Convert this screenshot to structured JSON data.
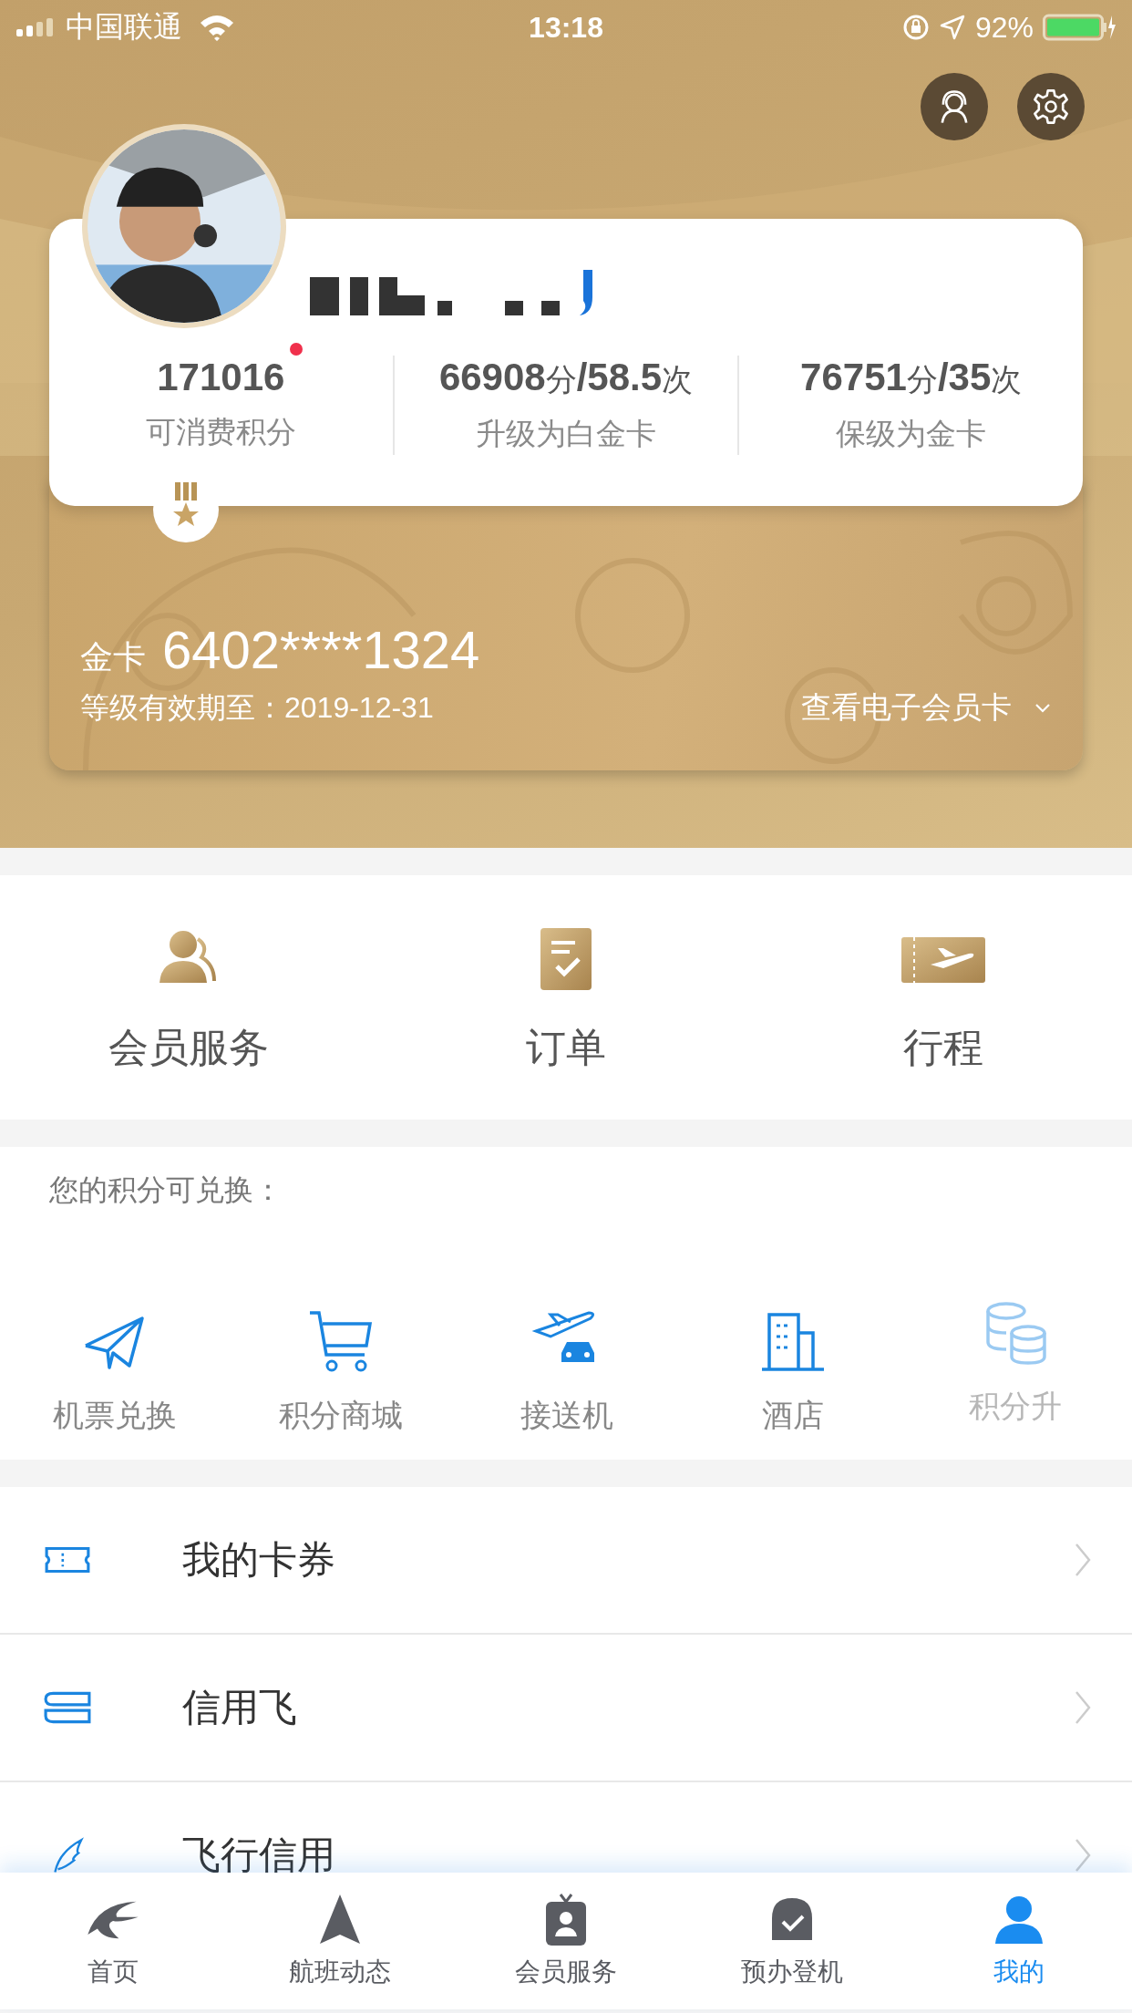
{
  "status_bar": {
    "carrier": "中国联通",
    "time": "13:18",
    "battery": "92%"
  },
  "profile": {
    "stats": [
      {
        "parts": [
          {
            "text": "171016",
            "kind": "num"
          }
        ],
        "label": "可消费积分"
      },
      {
        "parts": [
          {
            "text": "66908",
            "kind": "num"
          },
          {
            "text": "分",
            "kind": "unit"
          },
          {
            "text": "/58.5",
            "kind": "num"
          },
          {
            "text": "次",
            "kind": "unit"
          }
        ],
        "label": "升级为白金卡"
      },
      {
        "parts": [
          {
            "text": "76751",
            "kind": "num"
          },
          {
            "text": "分",
            "kind": "unit"
          },
          {
            "text": "/35",
            "kind": "num"
          },
          {
            "text": "次",
            "kind": "unit"
          }
        ],
        "label": "保级为金卡"
      }
    ],
    "notification_dot": true
  },
  "member_card": {
    "tier": "金卡",
    "number": "6402****1324",
    "validity": "等级有效期至：2019-12-31",
    "view_link": "查看电子会员卡"
  },
  "quick_actions": [
    "会员服务",
    "订单",
    "行程"
  ],
  "exchange": {
    "title": "您的积分可兑换：",
    "items": [
      "机票兑换",
      "积分商城",
      "接送机",
      "酒店",
      "积分升"
    ]
  },
  "list": [
    "我的卡券",
    "信用飞",
    "飞行信用"
  ],
  "tabs": [
    {
      "label": "首页",
      "selected": false
    },
    {
      "label": "航班动态",
      "selected": false
    },
    {
      "label": "会员服务",
      "selected": false
    },
    {
      "label": "预办登机",
      "selected": false
    },
    {
      "label": "我的",
      "selected": true
    }
  ]
}
